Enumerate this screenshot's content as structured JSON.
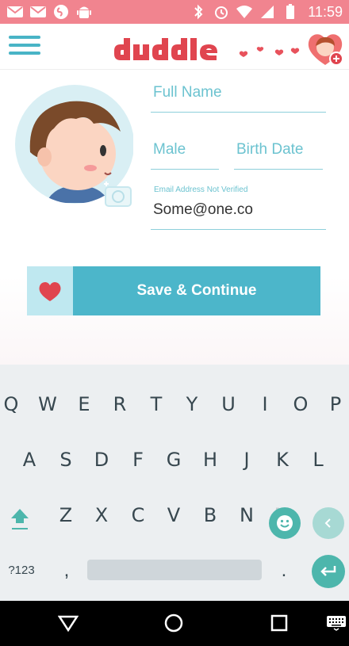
{
  "status_bar": {
    "time": "11:59",
    "background_color": "#f1848f",
    "icons_left": [
      "gmail-icon",
      "gmail-icon",
      "shazam-icon",
      "android-icon"
    ],
    "icons_right": [
      "bluetooth-icon",
      "alarm-icon",
      "wifi-icon",
      "signal-icon",
      "battery-icon"
    ]
  },
  "app_bar": {
    "brand": "duddle",
    "accent_color": "#49b4c6",
    "brand_color": "#e0454f"
  },
  "form": {
    "full_name_placeholder": "Full Name",
    "gender_placeholder": "Male",
    "birth_date_placeholder": "Birth Date",
    "email_label": "Email Address Not Verified",
    "email_value": "Some@one.co",
    "save_label": "Save & Continue"
  },
  "keyboard": {
    "row1": [
      "Q",
      "W",
      "E",
      "R",
      "T",
      "Y",
      "U",
      "I",
      "O",
      "P"
    ],
    "row2": [
      "A",
      "S",
      "D",
      "F",
      "G",
      "H",
      "J",
      "K",
      "L"
    ],
    "row3": [
      "Z",
      "X",
      "C",
      "V",
      "B",
      "N",
      "M"
    ],
    "symbols_label": "?123",
    "comma": ",",
    "period": "."
  }
}
